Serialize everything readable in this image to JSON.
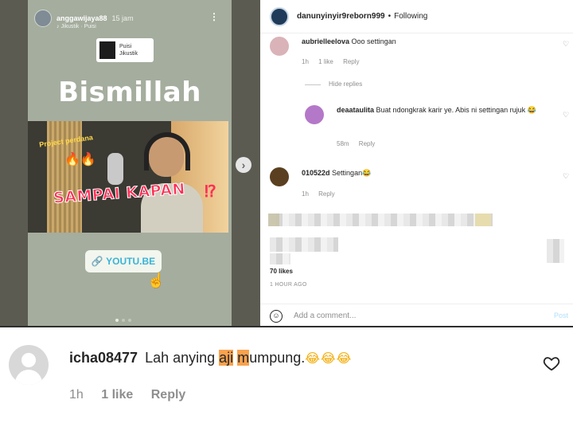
{
  "story": {
    "username": "anggawijaya88",
    "time": "15 jam",
    "subtitle": "♪ Jikustik · Puisi",
    "music_title": "Puisi",
    "music_artist": "Jikustik",
    "title": "Bismillah",
    "thumb_project": "Project perdana",
    "thumb_headline": "SAMPAI KAPAN",
    "thumb_mark": "⁉",
    "link_label": "YOUTU.BE",
    "icons": [
      "more-icon",
      "music-note-icon",
      "link-icon",
      "tap-hand-icon",
      "next-arrow-icon"
    ]
  },
  "post_header": {
    "username": "danunyinyir9reborn999",
    "separator": "•",
    "follow_status": "Following"
  },
  "comments": [
    {
      "user": "aubrielleelova",
      "text": "Ooo settingan",
      "time": "1h",
      "likes": "1 like",
      "reply": "Reply"
    },
    {
      "user": "deaataulita",
      "text": "Buat ndongkrak karir ye. Abis ni settingan rujuk 😂",
      "time": "58m",
      "reply": "Reply"
    },
    {
      "user": "010522d",
      "text": "Settingan😂",
      "time": "1h",
      "reply": "Reply"
    }
  ],
  "hide_replies": "Hide replies",
  "likes_fragment": "70 likes",
  "post_time": "1 HOUR AGO",
  "add_comment_placeholder": "Add a comment...",
  "post_button": "Post",
  "featured_comment": {
    "user": "icha08477",
    "text_before": "Lah anying ",
    "highlight_1": "aji",
    "text_mid": " ",
    "highlight_2": "m",
    "text_after": "umpung.",
    "emojis": "😂😂😂",
    "time": "1h",
    "likes": "1 like",
    "reply": "Reply"
  },
  "colors": {
    "highlight": "#f9a24d",
    "link": "#3bb3d8",
    "post_disabled": "#b2dffc"
  }
}
